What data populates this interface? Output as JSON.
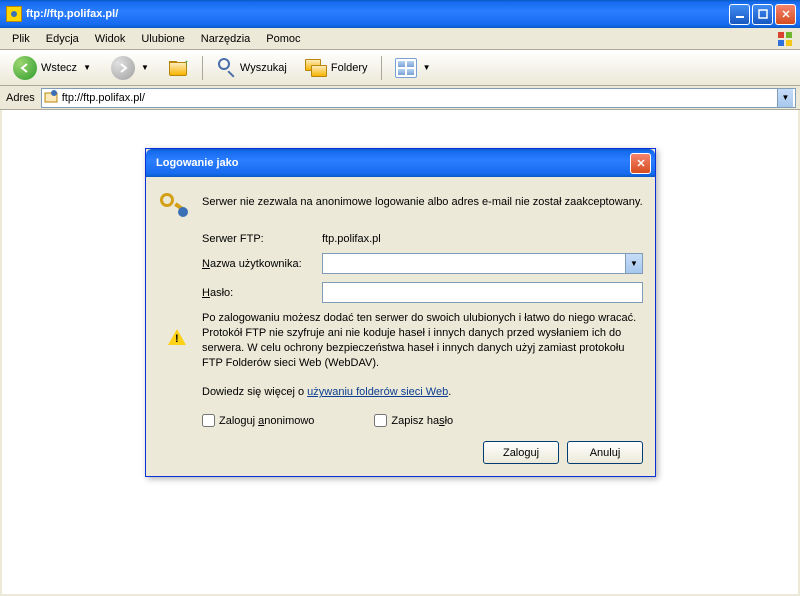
{
  "window": {
    "title": "ftp://ftp.polifax.pl/"
  },
  "menu": {
    "file": "Plik",
    "edit": "Edycja",
    "view": "Widok",
    "favorites": "Ulubione",
    "tools": "Narzędzia",
    "help": "Pomoc"
  },
  "toolbar": {
    "back": "Wstecz",
    "search": "Wyszukaj",
    "folders": "Foldery"
  },
  "address": {
    "label": "Adres",
    "value": "ftp://ftp.polifax.pl/"
  },
  "dialog": {
    "title": "Logowanie jako",
    "message": "Serwer nie zezwala na anonimowe logowanie albo adres e-mail nie został zaakceptowany.",
    "server_label": "Serwer FTP:",
    "server_value": "ftp.polifax.pl",
    "user_label_u": "N",
    "user_label_rest": "azwa użytkownika:",
    "user_value": "",
    "pass_label_u": "H",
    "pass_label_rest": "asło:",
    "pass_value": "",
    "info1": "Po zalogowaniu możesz dodać ten serwer do swoich ulubionych i łatwo do niego wracać.",
    "info2": "Protokół FTP nie szyfruje ani nie koduje haseł i innych danych przed wysłaniem ich do serwera. W celu ochrony bezpieczeństwa haseł i innych danych użyj zamiast protokołu FTP Folderów sieci Web (WebDAV).",
    "learn_prefix": "Dowiedz się więcej o ",
    "learn_link": "używaniu folderów sieci Web",
    "anon_u": "a",
    "anon_prefix": "Zaloguj ",
    "anon_rest": "nonimowo",
    "save_prefix": "Zapisz ha",
    "save_u": "s",
    "save_rest": "ło",
    "login_u": "Z",
    "login_rest": "aloguj",
    "cancel": "Anuluj"
  }
}
